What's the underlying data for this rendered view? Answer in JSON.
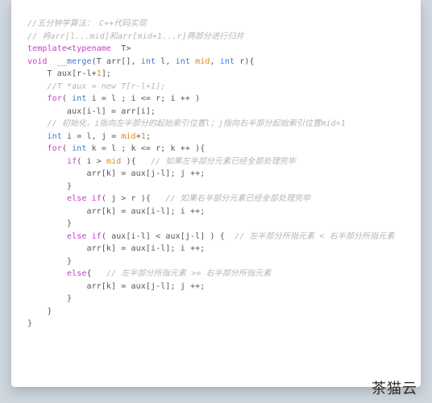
{
  "watermark": "茶猫云",
  "code": [
    [
      [
        "cm",
        "//五分钟学算法： C++代码实现"
      ]
    ],
    [
      [
        "",
        ""
      ]
    ],
    [
      [
        "cm",
        "// 将arr[l...mid]和arr[mid+1...r]两部分进行归并"
      ]
    ],
    [
      [
        "kw",
        "template"
      ],
      [
        "",
        "<"
      ],
      [
        "kw",
        "typename"
      ],
      [
        "",
        "  T>"
      ]
    ],
    [
      [
        "kw",
        "void"
      ],
      [
        "",
        "  "
      ],
      [
        "fn",
        "__merge"
      ],
      [
        "",
        "(T arr[], "
      ],
      [
        "ty",
        "int"
      ],
      [
        "",
        " l, "
      ],
      [
        "ty",
        "int"
      ],
      [
        "",
        " "
      ],
      [
        "nm",
        "mid"
      ],
      [
        "",
        ", "
      ],
      [
        "ty",
        "int"
      ],
      [
        "",
        " r){"
      ]
    ],
    [
      [
        "",
        ""
      ]
    ],
    [
      [
        "",
        "    T aux[r-l+"
      ],
      [
        "nm",
        "1"
      ],
      [
        "",
        "];"
      ]
    ],
    [
      [
        "",
        "    "
      ],
      [
        "cm",
        "//T *aux = new T[r-l+1];"
      ]
    ],
    [
      [
        "",
        ""
      ]
    ],
    [
      [
        "",
        "    "
      ],
      [
        "kw",
        "for"
      ],
      [
        "",
        "( "
      ],
      [
        "ty",
        "int"
      ],
      [
        "",
        " i = l ; i <= r; i ++ )"
      ]
    ],
    [
      [
        "",
        "        aux[i-l] = arr[i];"
      ]
    ],
    [
      [
        "",
        ""
      ]
    ],
    [
      [
        "",
        "    "
      ],
      [
        "cm",
        "// 初始化，i指向左半部分的起始索引位置l；j指向右半部分起始索引位置mid+1"
      ]
    ],
    [
      [
        "",
        "    "
      ],
      [
        "ty",
        "int"
      ],
      [
        "",
        " i = l, j = "
      ],
      [
        "nm",
        "mid"
      ],
      [
        "",
        "+"
      ],
      [
        "nm",
        "1"
      ],
      [
        "",
        ";"
      ]
    ],
    [
      [
        "",
        "    "
      ],
      [
        "kw",
        "for"
      ],
      [
        "",
        "( "
      ],
      [
        "ty",
        "int"
      ],
      [
        "",
        " k = l ; k <= r; k ++ ){"
      ]
    ],
    [
      [
        "",
        ""
      ]
    ],
    [
      [
        "",
        "        "
      ],
      [
        "kw",
        "if"
      ],
      [
        "",
        "( i > "
      ],
      [
        "nm",
        "mid"
      ],
      [
        "",
        " ){   "
      ],
      [
        "cm",
        "// 如果左半部分元素已经全部处理完毕"
      ]
    ],
    [
      [
        "",
        "            arr[k] = aux[j-l]; j ++;"
      ]
    ],
    [
      [
        "",
        "        }"
      ]
    ],
    [
      [
        "",
        "        "
      ],
      [
        "kw",
        "else"
      ],
      [
        "",
        " "
      ],
      [
        "kw",
        "if"
      ],
      [
        "",
        "( j > r ){   "
      ],
      [
        "cm",
        "// 如果右半部分元素已经全部处理完毕"
      ]
    ],
    [
      [
        "",
        "            arr[k] = aux[i-l]; i ++;"
      ]
    ],
    [
      [
        "",
        "        }"
      ]
    ],
    [
      [
        "",
        "        "
      ],
      [
        "kw",
        "else"
      ],
      [
        "",
        " "
      ],
      [
        "kw",
        "if"
      ],
      [
        "",
        "( aux[i-l] < aux[j-l] ) {  "
      ],
      [
        "cm",
        "// 左半部分所指元素 < 右半部分所指元素"
      ]
    ],
    [
      [
        "",
        "            arr[k] = aux[i-l]; i ++;"
      ]
    ],
    [
      [
        "",
        "        }"
      ]
    ],
    [
      [
        "",
        "        "
      ],
      [
        "kw",
        "else"
      ],
      [
        "",
        "{   "
      ],
      [
        "cm",
        "// 左半部分所指元素 >= 右半部分所指元素"
      ]
    ],
    [
      [
        "",
        "            arr[k] = aux[j-l]; j ++;"
      ]
    ],
    [
      [
        "",
        "        }"
      ]
    ],
    [
      [
        "",
        "    }"
      ]
    ],
    [
      [
        "",
        ""
      ]
    ],
    [
      [
        "",
        "}"
      ]
    ]
  ]
}
